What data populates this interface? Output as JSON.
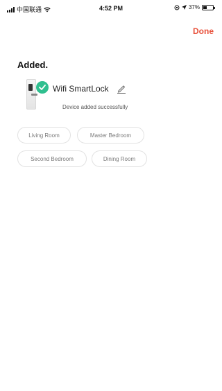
{
  "status_bar": {
    "carrier": "中国联通",
    "time": "4:52 PM",
    "battery_text": "37%"
  },
  "nav": {
    "done_label": "Done"
  },
  "page": {
    "title": "Added."
  },
  "device": {
    "name": "Wifi SmartLock",
    "status": "Device added successfully"
  },
  "rooms": [
    {
      "label": "Living Room"
    },
    {
      "label": "Master Bedroom"
    },
    {
      "label": "Second Bedroom"
    },
    {
      "label": "Dining Room"
    }
  ],
  "colors": {
    "accent": "#e8503a",
    "success": "#2fbf8f"
  }
}
